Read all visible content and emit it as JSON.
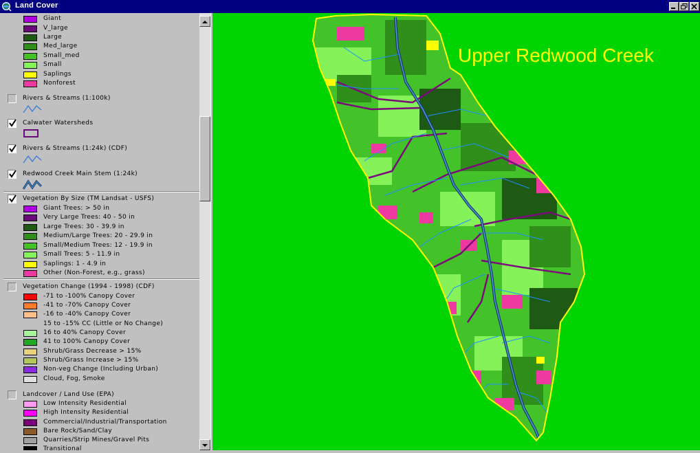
{
  "window": {
    "title": "Land Cover"
  },
  "colors": {
    "titlebar": "#000080",
    "map_background": "#00d400",
    "map_title": "#ffff00"
  },
  "legend": {
    "top_items": [
      {
        "label": "Giant",
        "color": "#b000e0"
      },
      {
        "label": "V_large",
        "color": "#6a0a7a"
      },
      {
        "label": "Large",
        "color": "#1f5a14"
      },
      {
        "label": "Med_large",
        "color": "#2f8f1a"
      },
      {
        "label": "Small_med",
        "color": "#44c22a"
      },
      {
        "label": "Small",
        "color": "#86f25a"
      },
      {
        "label": "Saplings",
        "color": "#ffff00"
      },
      {
        "label": "Nonforest",
        "color": "#ee3aa0"
      }
    ],
    "layers": {
      "rivers_100k": {
        "label": "Rivers & Streams (1:100k)",
        "checked": false
      },
      "calwater": {
        "label": "Calwater Watersheds",
        "checked": true
      },
      "rivers_24k": {
        "label": "Rivers & Streams (1:24k) (CDF)",
        "checked": true
      },
      "redwood_stem": {
        "label": "Redwood Creek Main Stem (1:24k)",
        "checked": true
      },
      "veg_size": {
        "label": "Vegetation By Size (TM Landsat - USFS)",
        "checked": true,
        "items": [
          {
            "label": "Giant Trees: > 50 in",
            "color": "#b000e0"
          },
          {
            "label": "Very Large Trees: 40 - 50 in",
            "color": "#6a0a7a"
          },
          {
            "label": "Large Trees: 30 - 39.9 in",
            "color": "#1f5a14"
          },
          {
            "label": "Medium/Large Trees: 20 - 29.9 in",
            "color": "#2f8f1a"
          },
          {
            "label": "Small/Medium Trees: 12 - 19.9 in",
            "color": "#44c22a"
          },
          {
            "label": "Small Trees: 5 - 11.9 in",
            "color": "#86f25a"
          },
          {
            "label": "Saplings: 1 - 4.9 in",
            "color": "#ffff00"
          },
          {
            "label": "Other (Non-Forest, e.g., grass)",
            "color": "#ee3aa0"
          }
        ]
      },
      "veg_change": {
        "label": "Vegetation Change (1994 - 1998) (CDF)",
        "checked": false,
        "items": [
          {
            "label": "-71 to -100% Canopy Cover",
            "color": "#ff0000"
          },
          {
            "label": "-41 to -70% Canopy Cover",
            "color": "#ff7a2a"
          },
          {
            "label": "-16 to -40% Canopy Cover",
            "color": "#ffc08a"
          },
          {
            "label": "15 to -15% CC (Little or No Change)",
            "color": ""
          },
          {
            "label": "16 to 40% Canopy Cover",
            "color": "#a8f59a"
          },
          {
            "label": "41 to 100% Canopy Cover",
            "color": "#22a822"
          },
          {
            "label": "Shrub/Grass Decrease > 15%",
            "color": "#e8d27a"
          },
          {
            "label": "Shrub/Grass Increase > 15%",
            "color": "#b2c85a"
          },
          {
            "label": "Non-veg Change (Including Urban)",
            "color": "#8a2be2"
          },
          {
            "label": "Cloud, Fog, Smoke",
            "color": "#e0e0e0"
          }
        ]
      },
      "landcover": {
        "label": "Landcover / Land Use (EPA)",
        "checked": false,
        "items": [
          {
            "label": "Low Intensity Residential",
            "color": "#ff9af0"
          },
          {
            "label": "High Intensity Residential",
            "color": "#ff00ff"
          },
          {
            "label": "Commercial/Industrial/Transportation",
            "color": "#7a007a"
          },
          {
            "label": "Bare Rock/Sand/Clay",
            "color": "#8a5a2a"
          },
          {
            "label": "Quarries/Strip Mines/Gravel Pits",
            "color": "#a0a0a0"
          },
          {
            "label": "Transitional",
            "color": "#000000"
          }
        ]
      }
    }
  },
  "map": {
    "title": "Upper Redwood Creek"
  }
}
